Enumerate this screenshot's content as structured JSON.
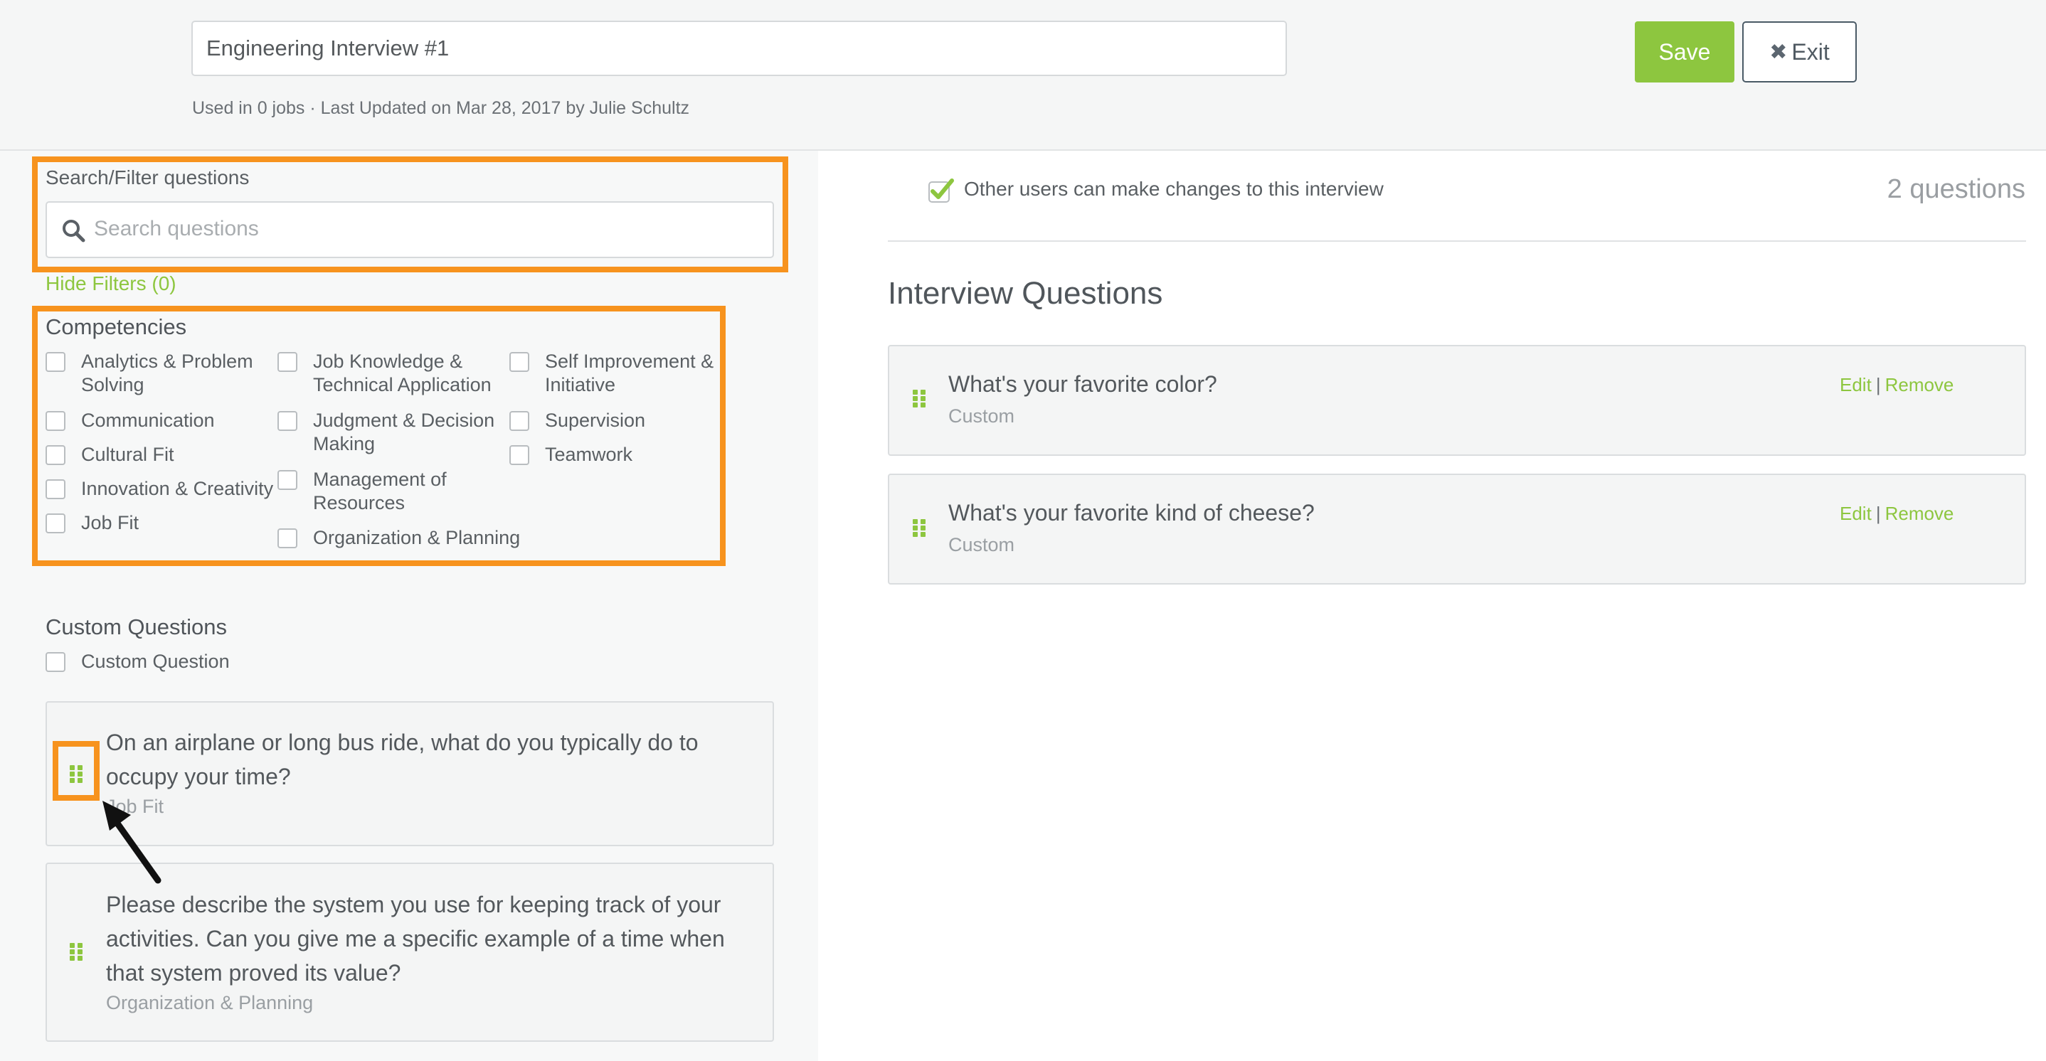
{
  "header": {
    "interview_title": "Engineering Interview #1",
    "meta": "Used in 0 jobs · Last Updated on Mar 28, 2017 by Julie Schultz",
    "save_label": "Save",
    "exit_label": "Exit",
    "exit_icon": "close-x-icon"
  },
  "filters": {
    "search_label": "Search/Filter questions",
    "search_placeholder": "Search questions",
    "hide_filters": "Hide Filters (0)",
    "competencies_title": "Competencies",
    "competencies": [
      "Analytics & Problem Solving",
      "Communication",
      "Cultural Fit",
      "Innovation & Creativity",
      "Job Fit",
      "Job Knowledge & Technical Application",
      "Judgment & Decision Making",
      "Management of Resources",
      "Organization & Planning",
      "Self Improvement & Initiative",
      "Supervision",
      "Teamwork"
    ],
    "custom_title": "Custom Questions",
    "custom_option": "Custom Question"
  },
  "question_bank": [
    {
      "text": "On an airplane or long bus ride, what do you typically do to occupy your time?",
      "category": "Job Fit"
    },
    {
      "text": "Please describe the system you use for keeping track of your activities. Can you give me a specific example of a time when that system proved its value?",
      "category": "Organization & Planning"
    }
  ],
  "interview": {
    "edit_permission_label": "Other users can make changes to this interview",
    "edit_permission_checked": true,
    "question_count": "2 questions",
    "section_title": "Interview Questions",
    "questions": [
      {
        "text": "What's your favorite color?",
        "category": "Custom",
        "edit": "Edit",
        "separator": "|",
        "remove": "Remove"
      },
      {
        "text": "What's your favorite kind of cheese?",
        "category": "Custom",
        "edit": "Edit",
        "separator": "|",
        "remove": "Remove"
      }
    ]
  },
  "colors": {
    "accent_green": "#8dc63f",
    "highlight_orange": "#f7931e"
  }
}
